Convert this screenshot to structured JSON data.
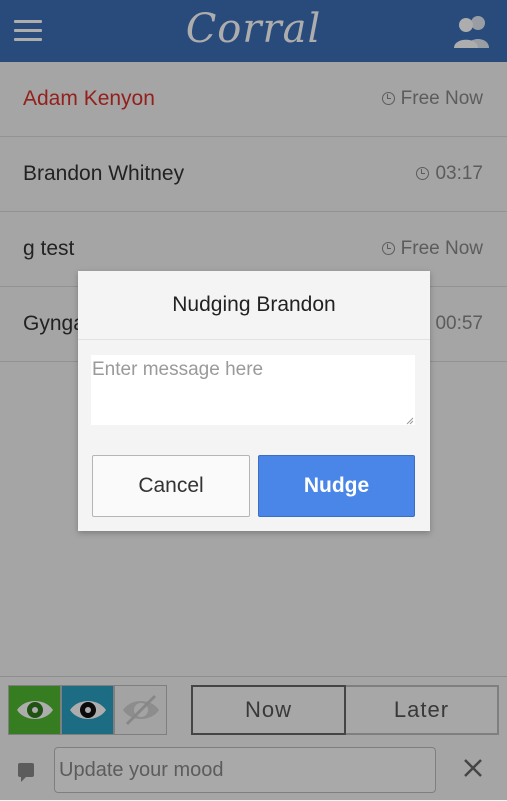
{
  "header": {
    "title": "Corral",
    "menu_icon": "hamburger-menu-icon",
    "contacts_icon": "contacts-icon"
  },
  "friends": [
    {
      "name": "Adam Kenyon",
      "status": "Free Now",
      "free": true
    },
    {
      "name": "Brandon Whitney",
      "status": "03:17",
      "free": false
    },
    {
      "name": "g test",
      "status": "Free Now",
      "free": false
    },
    {
      "name": "Gyngai Ung",
      "status": "00:57",
      "free": false
    }
  ],
  "dialog": {
    "title": "Nudging Brandon",
    "message_placeholder": "Enter message here",
    "cancel_label": "Cancel",
    "nudge_label": "Nudge"
  },
  "bottom": {
    "visibility_icons": [
      "eye-green-icon",
      "eye-teal-icon",
      "eye-off-icon"
    ],
    "now_label": "Now",
    "later_label": "Later",
    "mood_placeholder": "Update your mood"
  },
  "colors": {
    "header": "#3d6fb6",
    "free_name": "#d9302a",
    "nudge_button": "#4a86e8",
    "vis_green": "#4fb830",
    "vis_teal": "#2a9fc3"
  }
}
